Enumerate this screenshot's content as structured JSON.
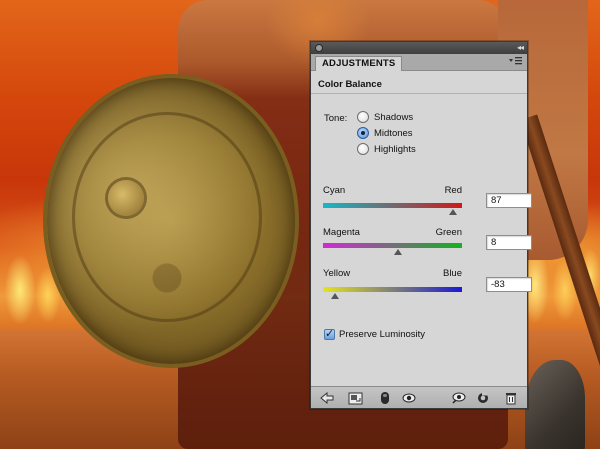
{
  "panel": {
    "tab_label": "ADJUSTMENTS",
    "collapse_glyph": "◂◂",
    "menu_icon": "panel-menu-icon",
    "title": "Color Balance"
  },
  "tone": {
    "label": "Tone:",
    "options": [
      "Shadows",
      "Midtones",
      "Highlights"
    ],
    "selected": "Midtones"
  },
  "sliders": [
    {
      "left": "Cyan",
      "right": "Red",
      "value": "87",
      "level": 87,
      "min": -100,
      "max": 100
    },
    {
      "left": "Magenta",
      "right": "Green",
      "value": "8",
      "level": 8,
      "min": -100,
      "max": 100
    },
    {
      "left": "Yellow",
      "right": "Blue",
      "value": "-83",
      "level": -83,
      "min": -100,
      "max": 100
    }
  ],
  "preserve_luminosity": {
    "label": "Preserve Luminosity",
    "checked": true
  },
  "footer_icons": [
    "back-arrow-icon",
    "clip-to-layer-icon",
    "layer-mask-icon",
    "visibility-eye-icon",
    "view-previous-state-icon",
    "reset-icon",
    "trash-icon"
  ]
}
